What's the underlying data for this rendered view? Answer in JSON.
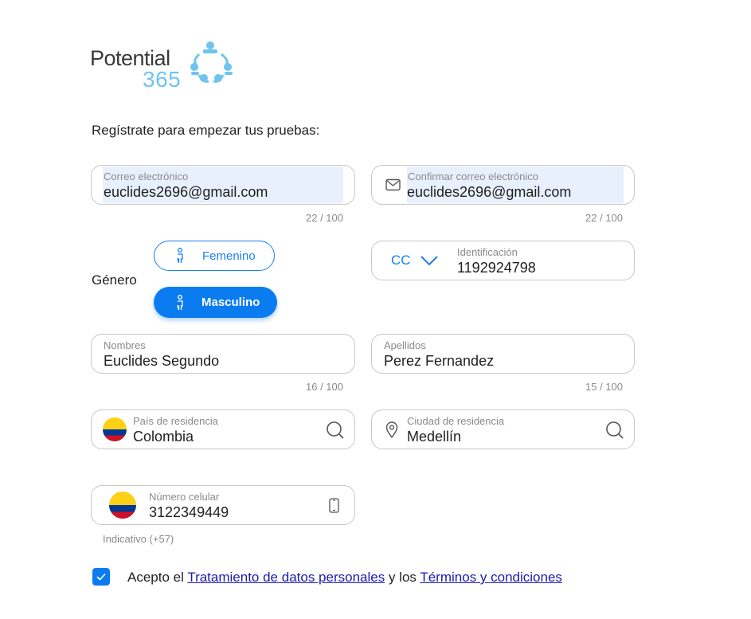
{
  "logo": {
    "word": "Potential",
    "number": "365"
  },
  "subtitle": "Regístrate para empezar tus pruebas:",
  "email": {
    "label": "Correo electrónico",
    "value": "euclides2696@gmail.com",
    "counter": "22 / 100"
  },
  "confirm_email": {
    "label": "Confirmar correo electrónico",
    "value": "euclides2696@gmail.com",
    "counter": "22 / 100"
  },
  "gender": {
    "label": "Género",
    "options": [
      "Femenino",
      "Masculino"
    ],
    "selected": "Masculino"
  },
  "id": {
    "type": "CC",
    "label": "Identificación",
    "value": "1192924798"
  },
  "names": {
    "label": "Nombres",
    "value": "Euclides Segundo",
    "counter": "16 / 100"
  },
  "surnames": {
    "label": "Apellidos",
    "value": "Perez Fernandez",
    "counter": "15 / 100"
  },
  "country": {
    "label": "País de residencia",
    "value": "Colombia"
  },
  "city": {
    "label": "Ciudad de residencia",
    "value": "Medellín"
  },
  "phone": {
    "label": "Número celular",
    "value": "3122349449",
    "hint": "Indicativo (+57)"
  },
  "terms": {
    "checked": true,
    "prefix": "Acepto el",
    "link1": "Tratamiento de datos personales",
    "middle": "y los",
    "link2": "Términos y condiciones"
  },
  "colors": {
    "accent": "#0b7cf0",
    "autofill": "#e8f0fe",
    "border": "#c7c7c7"
  }
}
